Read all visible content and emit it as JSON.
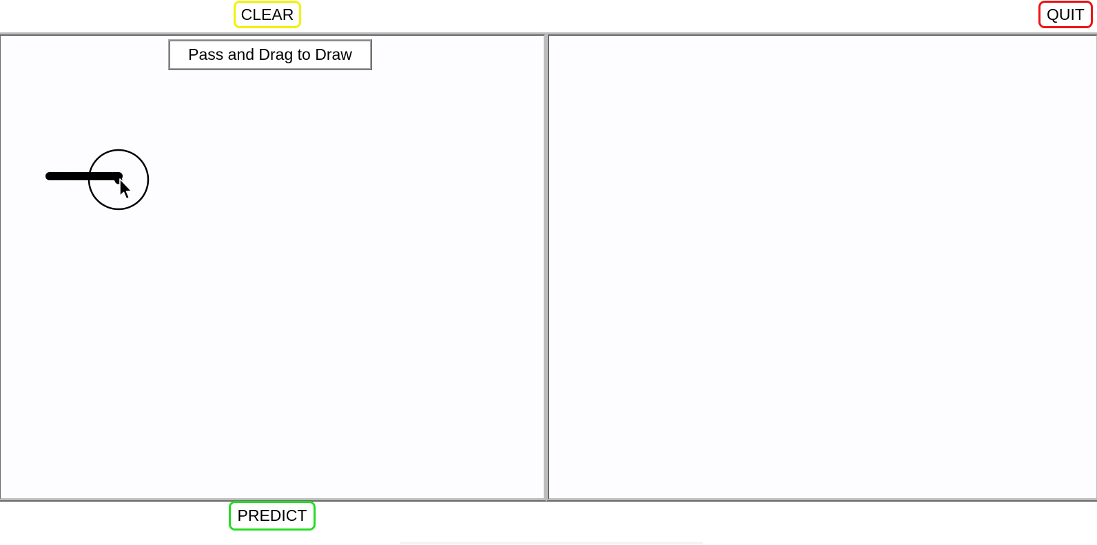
{
  "toolbar": {
    "clear_label": "CLEAR",
    "quit_label": "QUIT",
    "predict_label": "PREDICT"
  },
  "canvas": {
    "instruction_label": "Pass and Drag to Draw"
  },
  "colors": {
    "clear_border": "#f2f200",
    "quit_border": "#ee1111",
    "predict_border": "#22dd22",
    "panel_background": "#fdfdff"
  }
}
